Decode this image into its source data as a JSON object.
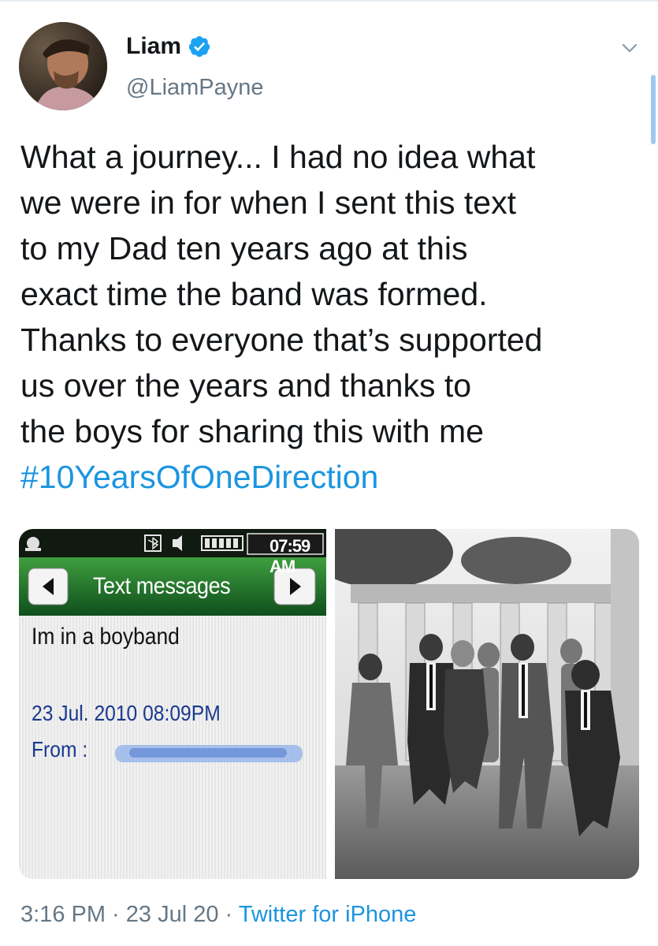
{
  "author": {
    "name": "Liam",
    "handle": "@LiamPayne",
    "verified": true
  },
  "tweet": {
    "lines": [
      "What a journey... I had no idea what",
      "we were in for when I sent this text",
      "to my Dad ten years ago at this",
      "exact time the band was formed.",
      "Thanks to everyone that’s supported",
      "us over the years and thanks to",
      "the boys for sharing this with me"
    ],
    "hashtag": "#10YearsOfOneDirection"
  },
  "media": {
    "phone_screenshot": {
      "status_time": "07:59 AM",
      "header_title": "Text messages",
      "message_body": "Im in a boyband",
      "message_date": "23 Jul. 2010 08:09PM",
      "from_label": "From :"
    },
    "band_photo": {
      "description_icon": "photo-icon"
    }
  },
  "footer": {
    "time": "3:16 PM",
    "separator": " · ",
    "date": "23 Jul 20",
    "separator2": " · ",
    "source": "Twitter for iPhone"
  },
  "colors": {
    "link_blue": "#1b95e0",
    "verified_blue": "#1da1f2",
    "phone_green": "#1f6f2a",
    "muted_gray": "#657786"
  }
}
